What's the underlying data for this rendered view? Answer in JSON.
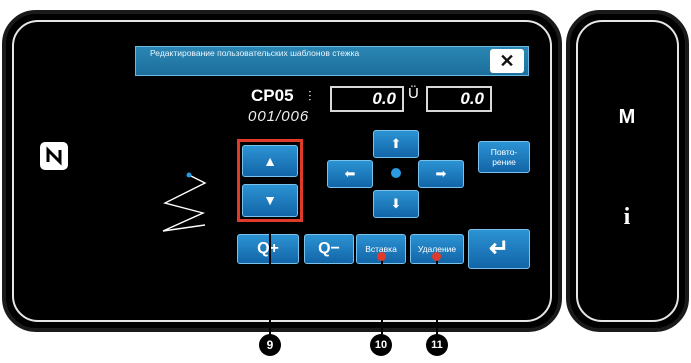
{
  "dialog": {
    "title": "Редактирование пользовательских шаблонов стежка",
    "close_glyph": "✕"
  },
  "pattern": {
    "name": "CP05",
    "x_value": "0.0",
    "y_value": "0.0",
    "stitch_counter": "001/006"
  },
  "buttons": {
    "up_glyph": "▲",
    "down_glyph": "▼",
    "move_up": "⬆",
    "move_down": "⬇",
    "move_left": "⬅",
    "move_right": "➡",
    "repeat_label": "Повто-рение",
    "zoom_in": "Q+",
    "zoom_out": "Q−",
    "insert_label": "Вставка",
    "delete_label": "Удаление",
    "enter_glyph": "↵"
  },
  "side": {
    "m_label": "M",
    "i_label": "i"
  },
  "callouts": [
    "9",
    "10",
    "11"
  ],
  "colors": {
    "screen_bg": "#000000",
    "button_blue": "#1a7bc0",
    "highlight_red": "#e03a2a"
  }
}
